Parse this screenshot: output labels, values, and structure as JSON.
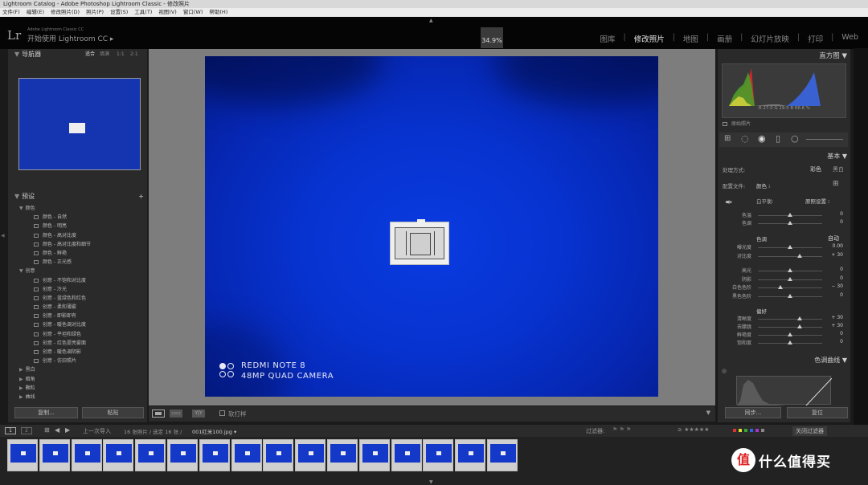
{
  "window": {
    "title": "Lightroom Catalog - Adobe Photoshop Lightroom Classic - 修改照片"
  },
  "menu": [
    "文件(F)",
    "编辑(E)",
    "修改照片(D)",
    "照片(P)",
    "设置(S)",
    "工具(T)",
    "视图(V)",
    "窗口(W)",
    "帮助(H)"
  ],
  "identity": {
    "logo": "Lr",
    "product": "Adobe Lightroom Classic CC",
    "start": "开始使用 Lightroom CC",
    "zoom": "34.9%"
  },
  "modules": [
    "图库",
    "修改照片",
    "地图",
    "画册",
    "幻灯片放映",
    "打印",
    "Web"
  ],
  "active_module": "修改照片",
  "navigator": {
    "title": "导航器",
    "zoom_options": [
      "适合",
      "填满",
      "1:1",
      "2:1"
    ]
  },
  "presets": {
    "title": "预设",
    "groups": [
      {
        "name": "颜色",
        "items": [
          "颜色 - 自然",
          "颜色 - 明亮",
          "颜色 - 高对比度",
          "颜色 - 高对比度和细节",
          "颜色 - 鲜艳",
          "颜色 - 正光感"
        ]
      },
      {
        "name": "创意",
        "items": [
          "创意 - 不饱和对比度",
          "创意 - 冷光",
          "创意 - 蓝绿色和红色",
          "创意 - 柔和薄雾",
          "创意 - 即影即有",
          "创意 - 暖色调对比度",
          "创意 - 平坦和绿色",
          "创意 - 红色提亮雾面",
          "创意 - 暖色调阴影",
          "创意 - 仿旧照片"
        ]
      },
      {
        "name": "黑白",
        "items": []
      },
      {
        "name": "暗角",
        "items": []
      },
      {
        "name": "颗粒",
        "items": []
      },
      {
        "name": "曲线",
        "items": []
      }
    ]
  },
  "left_buttons": {
    "copy": "复制...",
    "paste": "粘贴"
  },
  "photo": {
    "watermark_line1": "REDMI NOTE 8",
    "watermark_line2": "48MP QUAD CAMERA"
  },
  "toolbar": {
    "soft_proof": "软打样"
  },
  "histogram": {
    "title": "直方图",
    "readout": "R 27.0  G 19.5  B 66.6 %",
    "original_label": "原始照片"
  },
  "basic": {
    "title": "基本",
    "treatment_label": "处理方式:",
    "treatment_color": "彩色",
    "treatment_bw": "黑白",
    "profile_label": "配置文件:",
    "profile_value": "颜色",
    "wb_label": "白平衡:",
    "wb_value": "原照设置",
    "tone_label": "色调",
    "tone_auto": "自动",
    "presence_label": "偏好",
    "sliders_wb": [
      {
        "label": "色温",
        "value": "0",
        "pos": 0.5
      },
      {
        "label": "色调",
        "value": "0",
        "pos": 0.5
      }
    ],
    "sliders_tone": [
      {
        "label": "曝光度",
        "value": "0.00",
        "pos": 0.5
      },
      {
        "label": "对比度",
        "value": "+ 30",
        "pos": 0.65
      },
      {
        "label": "高光",
        "value": "0",
        "pos": 0.5
      },
      {
        "label": "阴影",
        "value": "0",
        "pos": 0.5
      },
      {
        "label": "白色色阶",
        "value": "− 30",
        "pos": 0.35
      },
      {
        "label": "黑色色阶",
        "value": "0",
        "pos": 0.5
      }
    ],
    "sliders_presence": [
      {
        "label": "清晰度",
        "value": "+ 30",
        "pos": 0.65
      },
      {
        "label": "去朦胧",
        "value": "+ 30",
        "pos": 0.65
      },
      {
        "label": "鲜艳度",
        "value": "0",
        "pos": 0.5
      },
      {
        "label": "饱和度",
        "value": "0",
        "pos": 0.5
      }
    ]
  },
  "tone_curve": {
    "title": "色调曲线"
  },
  "right_buttons": {
    "sync": "同步...",
    "reset": "复位"
  },
  "filmbar": {
    "pages": [
      "1",
      "2"
    ],
    "source": "上一次导入",
    "count": "16 张照片 / 选定 16 张 /",
    "filename": "001红米100.jpg",
    "filter_label": "过滤器:",
    "filter_off": "关闭过滤器"
  },
  "filmstrip_count": 16,
  "brand_watermark": {
    "circle": "值",
    "text": "什么值得买"
  }
}
